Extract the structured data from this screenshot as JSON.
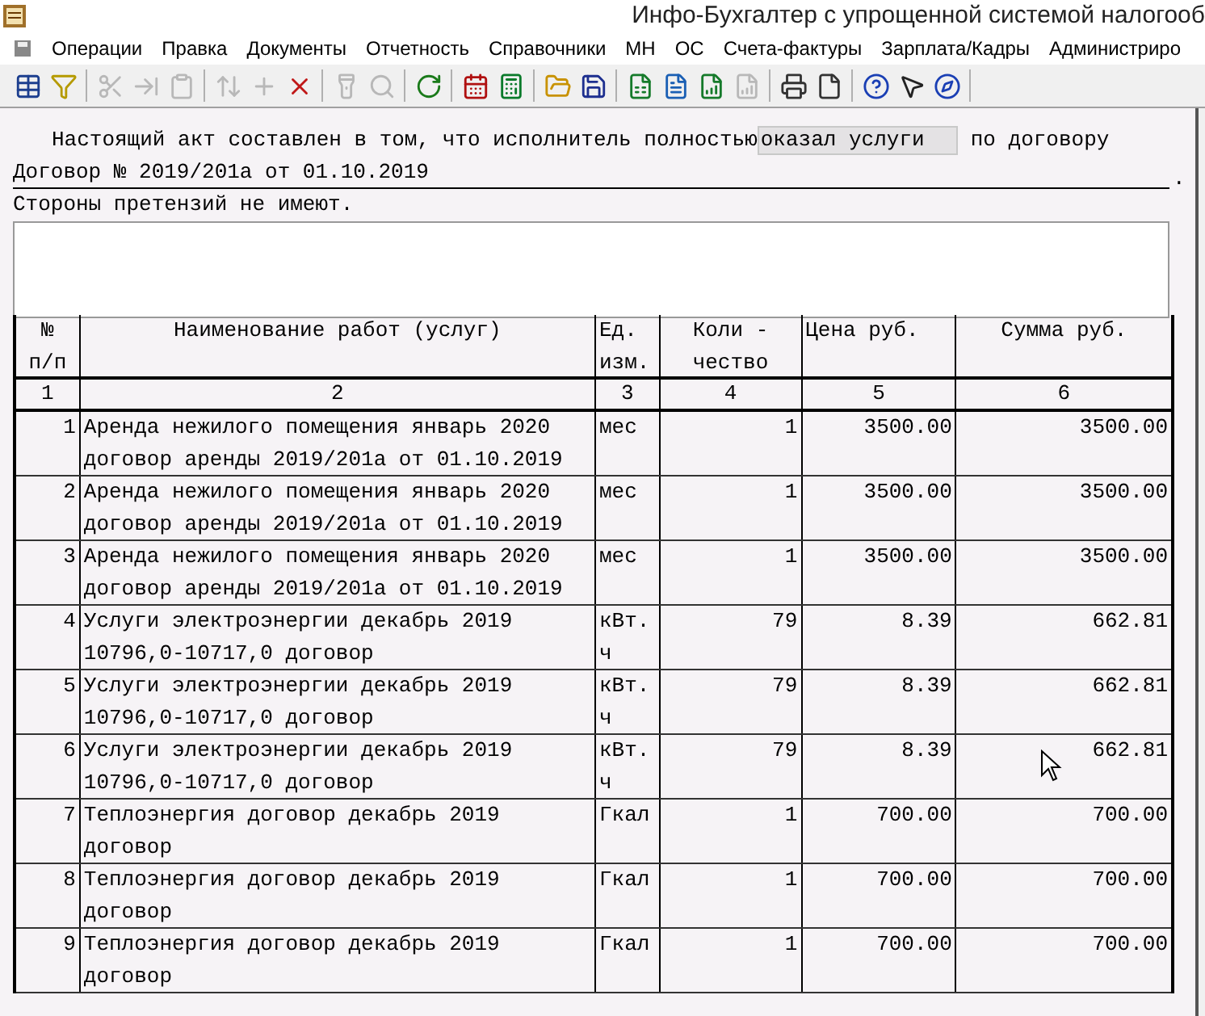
{
  "window": {
    "title": "Инфо-Бухгалтер с упрощенной системой налогооб"
  },
  "menu": [
    "Операции",
    "Правка",
    "Документы",
    "Отчетность",
    "Справочники",
    "МН",
    "ОС",
    "Счета-фактуры",
    "Зарплата/Кадры",
    "Администриро"
  ],
  "toolbar": [
    {
      "kind": "table",
      "disabled": false
    },
    {
      "kind": "filter",
      "disabled": false
    },
    {
      "kind": "sep"
    },
    {
      "kind": "cut",
      "disabled": true
    },
    {
      "kind": "move",
      "disabled": true
    },
    {
      "kind": "paste",
      "disabled": true
    },
    {
      "kind": "sep"
    },
    {
      "kind": "sort",
      "disabled": true
    },
    {
      "kind": "add",
      "disabled": true
    },
    {
      "kind": "delete",
      "disabled": false
    },
    {
      "kind": "sep"
    },
    {
      "kind": "find",
      "disabled": true
    },
    {
      "kind": "findnext",
      "disabled": true
    },
    {
      "kind": "sep"
    },
    {
      "kind": "refresh",
      "disabled": false
    },
    {
      "kind": "sep"
    },
    {
      "kind": "calendar",
      "disabled": false
    },
    {
      "kind": "calculator",
      "disabled": false
    },
    {
      "kind": "sep"
    },
    {
      "kind": "open",
      "disabled": false
    },
    {
      "kind": "save",
      "disabled": false
    },
    {
      "kind": "sep"
    },
    {
      "kind": "excel",
      "disabled": false
    },
    {
      "kind": "word",
      "disabled": false
    },
    {
      "kind": "report",
      "disabled": false
    },
    {
      "kind": "report",
      "disabled": true
    },
    {
      "kind": "sep"
    },
    {
      "kind": "print",
      "disabled": false
    },
    {
      "kind": "page",
      "disabled": false
    },
    {
      "kind": "sep"
    },
    {
      "kind": "help",
      "disabled": false
    },
    {
      "kind": "whatsthis",
      "disabled": false
    },
    {
      "kind": "compass",
      "disabled": false
    },
    {
      "kind": "sep"
    }
  ],
  "act": {
    "text_before": "Настоящий акт составлен в том, что исполнитель полностью",
    "field_value": "оказал услуги",
    "text_after": "по договору",
    "contract": "Договор № 2019/201а от 01.10.2019",
    "period": ".",
    "claims": "Стороны претензий не имеют."
  },
  "table": {
    "columns": [
      "№\nп/п",
      "Наименование работ (услуг)",
      "Ед.\nизм.",
      "Коли -\nчество",
      "Цена  руб.",
      "Сумма  руб."
    ],
    "column_numbers": [
      "1",
      "2",
      "3",
      "4",
      "5",
      "6"
    ],
    "rows": [
      [
        "1",
        "Аренда нежилого помещения январь 2020 договор аренды 2019/201а от 01.10.2019",
        "мес",
        "1",
        "3500.00",
        "3500.00"
      ],
      [
        "2",
        "Аренда нежилого помещения январь 2020 договор аренды 2019/201а от 01.10.2019",
        "мес",
        "1",
        "3500.00",
        "3500.00"
      ],
      [
        "3",
        "Аренда нежилого помещения январь 2020 договор аренды 2019/201а от 01.10.2019",
        "мес",
        "1",
        "3500.00",
        "3500.00"
      ],
      [
        "4",
        "Услуги электроэнергии декабрь 2019 10796,0-10717,0 договор",
        "кВт.ч",
        "79",
        "8.39",
        "662.81"
      ],
      [
        "5",
        "Услуги электроэнергии декабрь 2019 10796,0-10717,0 договор",
        "кВт.ч",
        "79",
        "8.39",
        "662.81"
      ],
      [
        "6",
        "Услуги электроэнергии декабрь 2019 10796,0-10717,0 договор",
        "кВт.ч",
        "79",
        "8.39",
        "662.81"
      ],
      [
        "7",
        "Теплоэнергия договор декабрь 2019 договор",
        "Гкал",
        "1",
        "700.00",
        "700.00"
      ],
      [
        "8",
        "Теплоэнергия договор декабрь 2019 договор",
        "Гкал",
        "1",
        "700.00",
        "700.00"
      ],
      [
        "9",
        "Теплоэнергия договор декабрь 2019 договор",
        "Гкал",
        "1",
        "700.00",
        "700.00"
      ]
    ]
  }
}
